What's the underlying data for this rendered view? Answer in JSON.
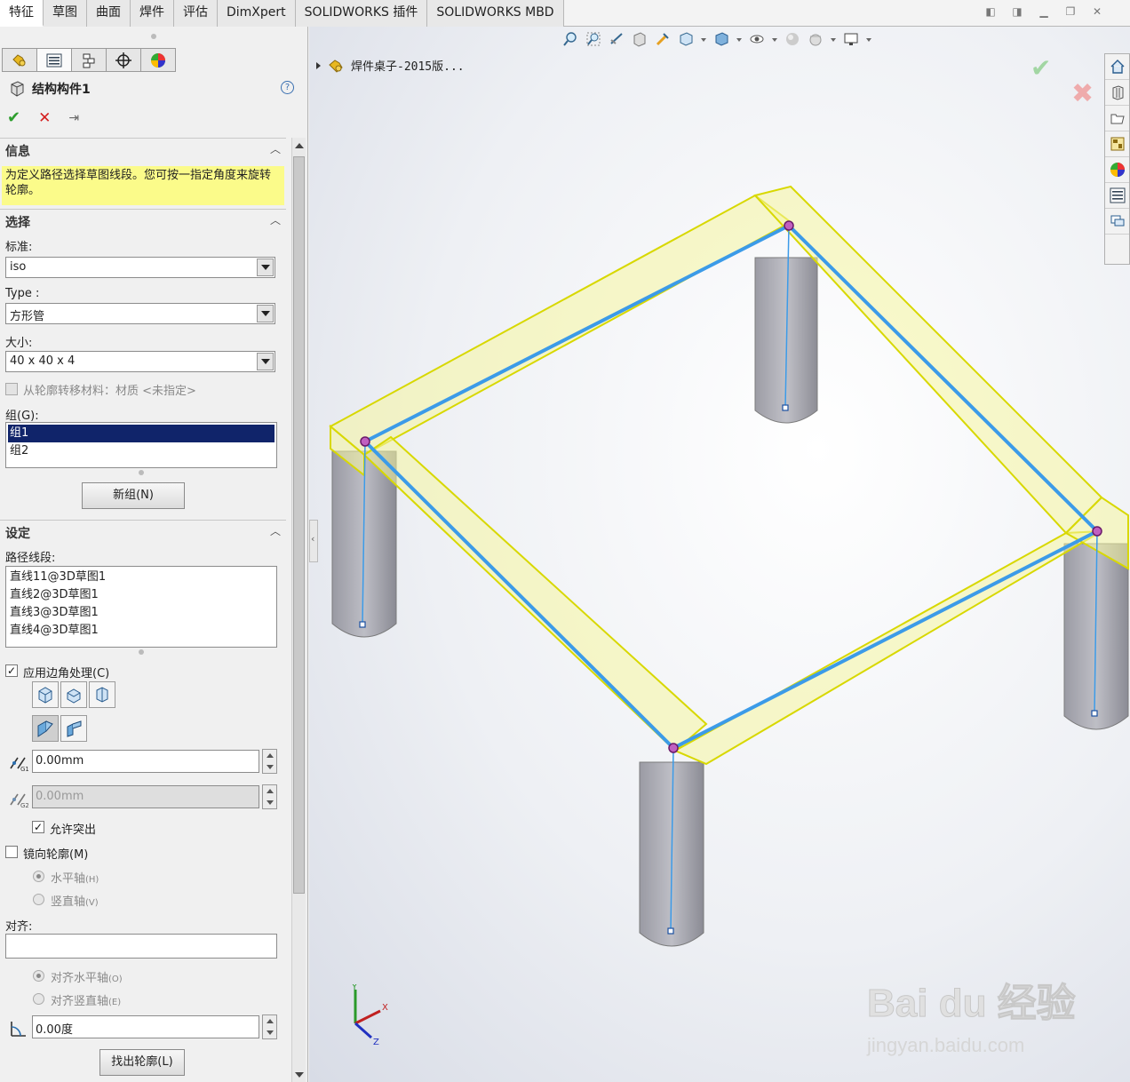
{
  "ribbon": {
    "tabs": [
      "特征",
      "草图",
      "曲面",
      "焊件",
      "评估",
      "DimXpert",
      "SOLIDWORKS 插件",
      "SOLIDWORKS MBD"
    ],
    "active_tab": "特征"
  },
  "property_manager": {
    "title": "结构构件1",
    "help": "?",
    "info": {
      "header": "信息",
      "message": "为定义路径选择草图线段。您可按一指定角度来旋转轮廓。"
    },
    "selection": {
      "header": "选择",
      "standard_label": "标准:",
      "standard_value": "iso",
      "type_label": "Type :",
      "type_value": "方形管",
      "size_label": "大小:",
      "size_value": "40 x 40 x 4",
      "transfer_material_label": "从轮廓转移材料：材质 <未指定>",
      "group_label": "组(G):",
      "groups": [
        "组1",
        "组2"
      ],
      "new_group_button": "新组(N)"
    },
    "settings": {
      "header": "设定",
      "path_segments_label": "路径线段:",
      "path_segments": [
        "直线11@3D草图1",
        "直线2@3D草图1",
        "直线3@3D草图1",
        "直线4@3D草图1"
      ],
      "apply_corner_label": "应用边角处理(C)",
      "gap1_value": "0.00mm",
      "gap2_value": "0.00mm",
      "allow_protrusion_label": "允许突出",
      "mirror_profile_label": "镜向轮廓(M)",
      "horizontal_axis_label": "水平轴",
      "horizontal_axis_key": "(H)",
      "vertical_axis_label": "竖直轴",
      "vertical_axis_key": "(V)",
      "align_label": "对齐:",
      "align_horizontal_label": "对齐水平轴",
      "align_horizontal_key": "(O)",
      "align_vertical_label": "对齐竖直轴",
      "align_vertical_key": "(E)",
      "rotation_value": "0.00度",
      "locate_profile_button": "找出轮廓(L)"
    }
  },
  "viewport": {
    "tree_item": "焊件桌子-2015版...",
    "triad_labels": {
      "x": "X",
      "y": "Y",
      "z": "Z"
    },
    "watermark_text": "Bai du 经验",
    "watermark_sub": "jingyan.baidu.com"
  },
  "colors": {
    "selection_yellow": "#f2f200",
    "sketch_blue": "#3c9be8",
    "group_selected": "#10246a",
    "info_yellow": "#fbfb8a"
  }
}
